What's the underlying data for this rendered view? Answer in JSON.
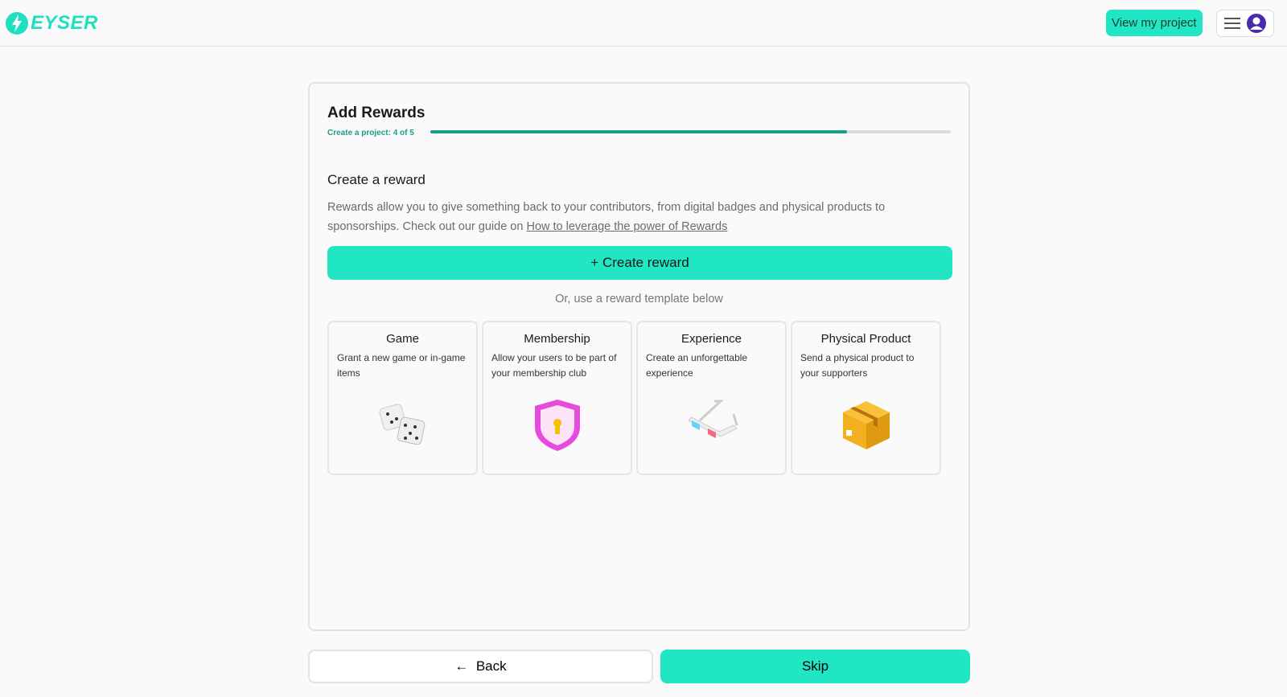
{
  "header": {
    "logo_text": "EYSER",
    "view_project_label": "View my project",
    "menu_icon": "hamburger-icon",
    "avatar_icon": "user-avatar-icon"
  },
  "card": {
    "title": "Add Rewards",
    "step_label": "Create a project: 4 of 5",
    "progress_percent": 80,
    "section_title": "Create a reward",
    "description": "Rewards allow you to give something back to your contributors, from digital badges and physical products to sponsorships. Check out our guide on ",
    "guide_link": "How to leverage the power of Rewards",
    "create_button": "Create reward",
    "template_hint": "Or, use a reward template below",
    "templates": [
      {
        "title": "Game",
        "description": "Grant a new game or in-game items",
        "icon": "dice-icon"
      },
      {
        "title": "Membership",
        "description": "Allow your users to be part of your membership club",
        "icon": "shield-keyhole-icon"
      },
      {
        "title": "Experience",
        "description": "Create an unforgettable experience",
        "icon": "3d-glasses-icon"
      },
      {
        "title": "Physical Product",
        "description": "Send a physical product to your supporters",
        "icon": "package-box-icon"
      }
    ]
  },
  "footer": {
    "back_label": "Back",
    "skip_label": "Skip"
  },
  "colors": {
    "accent": "#20e6c4",
    "progress": "#1a9e87"
  }
}
